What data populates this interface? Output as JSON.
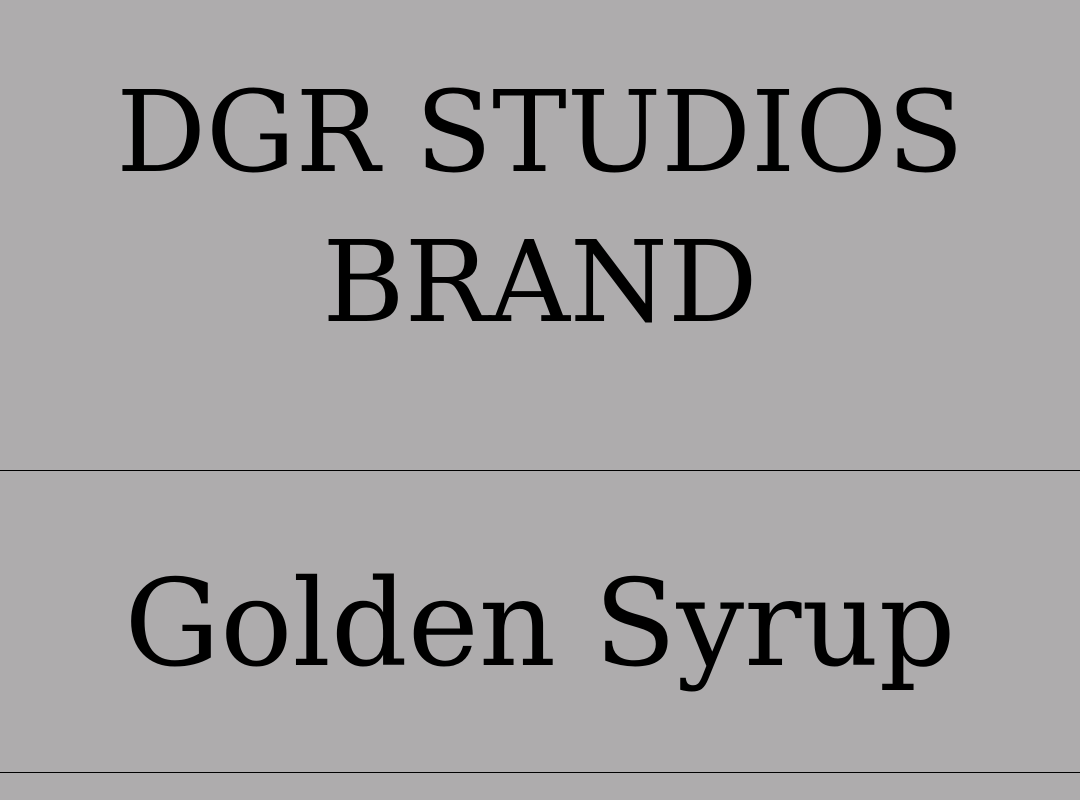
{
  "label": {
    "brand_line1": "DGR STUDIOS",
    "brand_line2": "BRAND",
    "product_name": "Golden Syrup"
  },
  "colors": {
    "background": "#aeacad",
    "text": "#000000",
    "divider": "#000000"
  }
}
